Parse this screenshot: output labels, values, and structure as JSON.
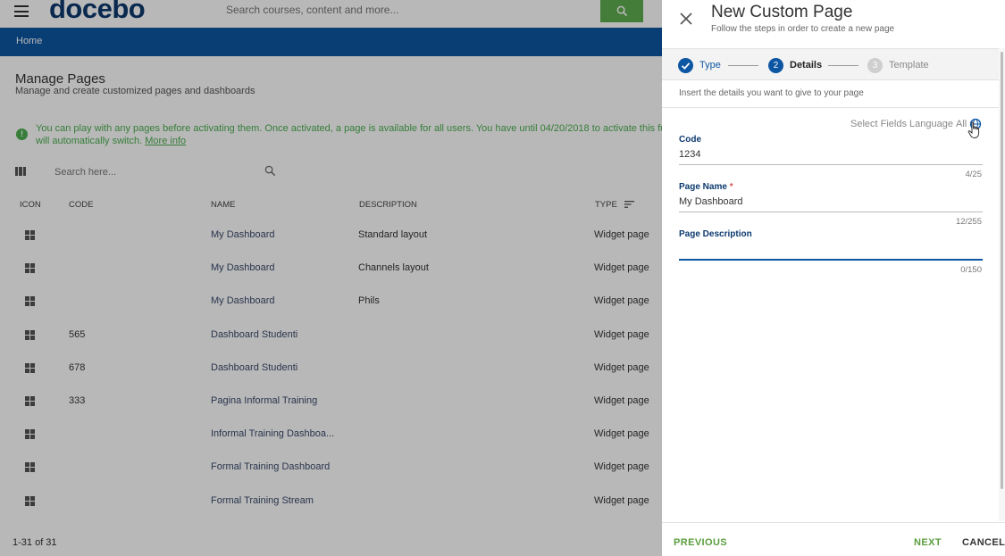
{
  "topbar": {
    "logo": "docebo",
    "logo_mark": "®",
    "search_placeholder": "Search courses, content and more..."
  },
  "nav": {
    "home": "Home"
  },
  "page": {
    "title": "Manage Pages",
    "subtitle": "Manage and create customized pages and dashboards",
    "notice_line1": "You can play with any pages before activating them. Once activated, a page is available for all users. You have until 04/20/2018 to activate this functionality, after that time it",
    "notice_line2_prefix": "will automatically switch.",
    "notice_more": "More info",
    "search_placeholder": "Search here..."
  },
  "table": {
    "headers": {
      "icon": "ICON",
      "code": "CODE",
      "name": "NAME",
      "description": "DESCRIPTION",
      "type": "TYPE"
    },
    "rows": [
      {
        "code": "",
        "name": "My Dashboard",
        "description": "Standard layout",
        "type": "Widget page"
      },
      {
        "code": "",
        "name": "My Dashboard",
        "description": "Channels layout",
        "type": "Widget page"
      },
      {
        "code": "",
        "name": "My Dashboard",
        "description": "Phils",
        "type": "Widget page"
      },
      {
        "code": "565",
        "name": "Dashboard Studenti",
        "description": "",
        "type": "Widget page"
      },
      {
        "code": "678",
        "name": "Dashboard Studenti",
        "description": "",
        "type": "Widget page"
      },
      {
        "code": "333",
        "name": "Pagina Informal Training",
        "description": "",
        "type": "Widget page"
      },
      {
        "code": "",
        "name": "Informal Training Dashboa...",
        "description": "",
        "type": "Widget page"
      },
      {
        "code": "",
        "name": "Formal Training Dashboard",
        "description": "",
        "type": "Widget page"
      },
      {
        "code": "",
        "name": "Formal Training Stream",
        "description": "",
        "type": "Widget page"
      }
    ],
    "pagination": "1-31 of 31"
  },
  "panel": {
    "title": "New Custom Page",
    "subtitle": "Follow the steps in order to create a new page",
    "steps": [
      {
        "number": "1",
        "label": "Type",
        "state": "done"
      },
      {
        "number": "2",
        "label": "Details",
        "state": "active"
      },
      {
        "number": "3",
        "label": "Template",
        "state": "pending"
      }
    ],
    "insert_text": "Insert the details you want to give to your page",
    "language_label": "Select Fields Language",
    "language_value": "All",
    "fields": {
      "code": {
        "label": "Code",
        "value": "1234",
        "counter": "4/25"
      },
      "page_name": {
        "label": "Page Name",
        "required_mark": "*",
        "value": "My Dashboard",
        "counter": "12/255"
      },
      "page_description": {
        "label": "Page Description",
        "value": "",
        "counter": "0/150"
      }
    },
    "buttons": {
      "previous": "PREVIOUS",
      "next": "NEXT",
      "cancel": "CANCEL"
    }
  },
  "colors": {
    "brand_navy": "#0d3a6e",
    "nav_blue": "#0d56a3",
    "success_green": "#4caf50",
    "button_green": "#5fae50"
  }
}
